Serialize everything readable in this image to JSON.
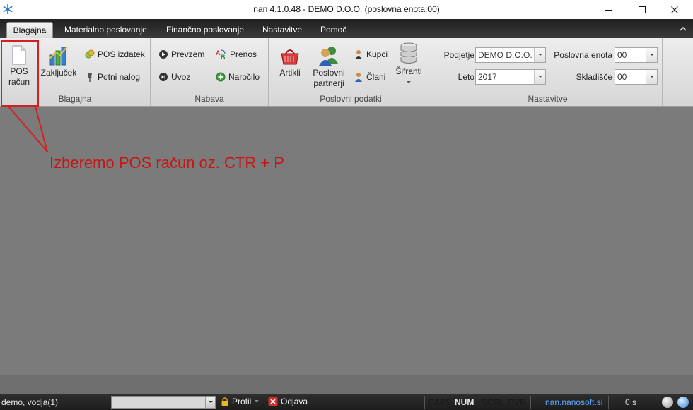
{
  "window": {
    "title": "nan 4.1.0.48 - DEMO D.O.O. (poslovna enota:00)",
    "icons": {
      "app": "snowflake-icon",
      "minimize": "minimize-icon",
      "maximize": "maximize-icon",
      "close": "close-icon"
    }
  },
  "tabs": [
    {
      "label": "Blagajna",
      "active": true
    },
    {
      "label": "Materialno poslovanje",
      "active": false
    },
    {
      "label": "Finančno poslovanje",
      "active": false
    },
    {
      "label": "Nastavitve",
      "active": false
    },
    {
      "label": "Pomoč",
      "active": false
    }
  ],
  "ribbon": {
    "blagajna": {
      "label": "Blagajna",
      "pos_racun": [
        "POS",
        "račun"
      ],
      "zakljucek": "Zaključek",
      "pos_izdatek": "POS izdatek",
      "potni_nalog": "Potni nalog"
    },
    "nabava": {
      "label": "Nabava",
      "prevzem": "Prevzem",
      "uvoz": "Uvoz",
      "prenos": "Prenos",
      "narocilo": "Naročilo"
    },
    "poslovni": {
      "label": "Poslovni podatki",
      "artikli": "Artikli",
      "partnerji": [
        "Poslovni",
        "partnerji"
      ],
      "kupci": "Kupci",
      "clani": "Člani",
      "sifranti": "Šifranti"
    },
    "nastavitve": {
      "label": "Nastavitve",
      "podjetje_label": "Podjetje",
      "podjetje_value": "DEMO D.O.O.",
      "leto_label": "Leto",
      "leto_value": "2017",
      "enota_label": "Poslovna enota",
      "enota_value": "00",
      "skladisce_label": "Skladišče",
      "skladisce_value": "00"
    }
  },
  "annotation": {
    "text": "Izberemo POS račun oz. CTR + P",
    "color": "#c81414"
  },
  "status": {
    "user": "demo, vodja(1)",
    "profil": "Profil",
    "odjava": "Odjava",
    "keys": [
      {
        "label": "CAPS",
        "on": false
      },
      {
        "label": "NUM",
        "on": true
      },
      {
        "label": "SCRL",
        "on": false
      },
      {
        "label": "OVR",
        "on": false
      }
    ],
    "link": "nan.nanosoft.si",
    "timer": "0 s"
  }
}
